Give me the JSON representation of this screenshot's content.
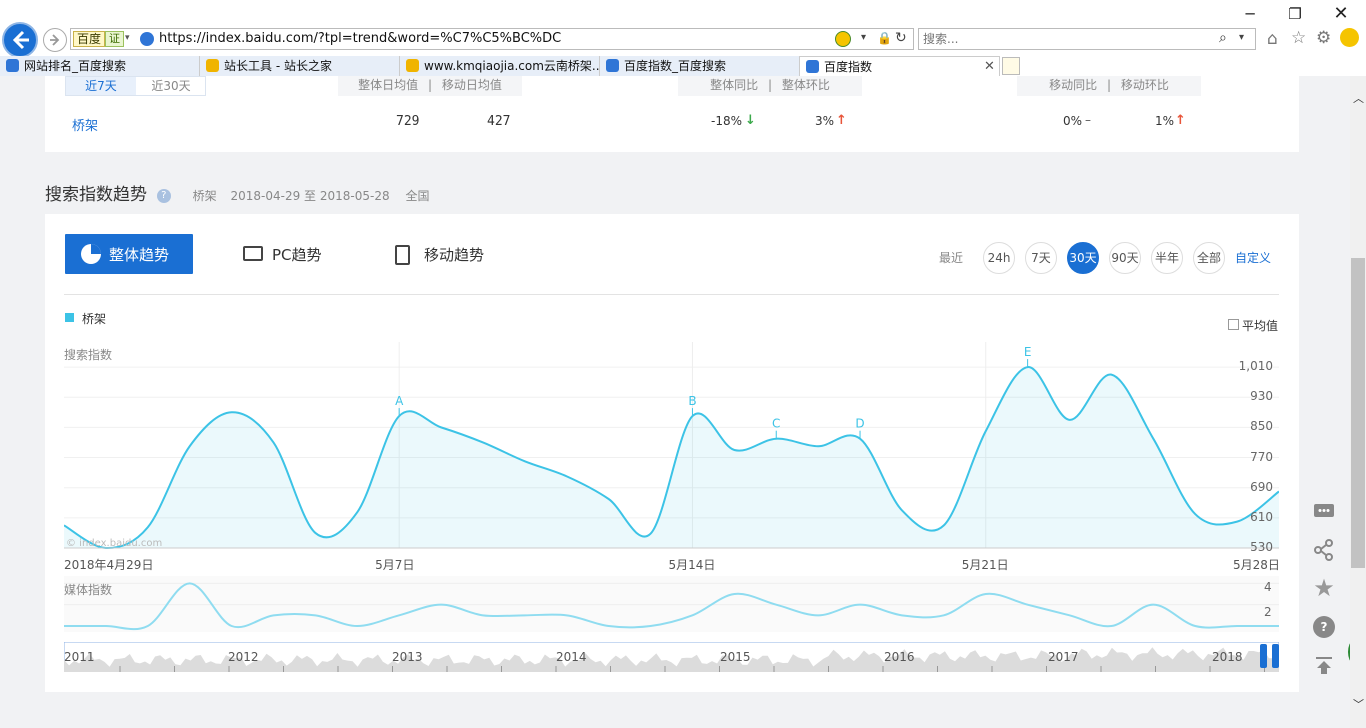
{
  "browser": {
    "url": "https://index.baidu.com/?tpl=trend&word=%C7%C5%BC%DC",
    "site_badge": "百度",
    "cert_badge": "证",
    "search_placeholder": "搜索...",
    "tabs": [
      {
        "label": "网站排名_百度搜索",
        "active": false
      },
      {
        "label": "站长工具 - 站长之家",
        "active": false
      },
      {
        "label": "www.kmqiaojia.com云南桥架...",
        "active": false
      },
      {
        "label": "百度指数_百度搜索",
        "active": false
      },
      {
        "label": "百度指数",
        "active": true
      }
    ]
  },
  "summary": {
    "period_tabs": [
      "近7天",
      "近30天"
    ],
    "col_headers": {
      "avg": [
        "整体日均值",
        "|",
        "移动日均值"
      ],
      "yoy": [
        "整体同比",
        "|",
        "整体环比"
      ],
      "mob": [
        "移动同比",
        "|",
        "移动环比"
      ]
    },
    "row": {
      "keyword": "桥架",
      "overall_avg": "729",
      "mobile_avg": "427",
      "overall_yoy": "-18%",
      "overall_mom": "3%",
      "mobile_yoy": "0%",
      "mobile_mom": "1%"
    },
    "colors": {
      "up": "#e8553a",
      "down": "#3ba94b"
    }
  },
  "trend": {
    "title": "搜索指数趋势",
    "meta": {
      "keyword": "桥架",
      "range": "2018-04-29 至 2018-05-28",
      "region": "全国"
    },
    "view_tabs": [
      {
        "label": "整体趋势",
        "active": true,
        "icon": "pie-icon"
      },
      {
        "label": "PC趋势",
        "active": false,
        "icon": "monitor-icon"
      },
      {
        "label": "移动趋势",
        "active": false,
        "icon": "phone-icon"
      }
    ],
    "recent_label": "最近",
    "ranges": [
      "24h",
      "7天",
      "30天",
      "90天",
      "半年",
      "全部"
    ],
    "active_range": "30天",
    "custom_label": "自定义",
    "avg_toggle": "平均值",
    "watermark": "© index.baidu.com",
    "accent": "#1a6fd3",
    "series_color": "#3cc3e6"
  },
  "chart_data": [
    {
      "type": "area",
      "ylabel": "搜索指数",
      "legend": [
        {
          "name": "桥架",
          "color": "#3cc3e6"
        }
      ],
      "x_ticks": [
        "2018年4月29日",
        "5月7日",
        "5月14日",
        "5月21日",
        "5月28日"
      ],
      "y_ticks": [
        "1,010",
        "930",
        "850",
        "770",
        "690",
        "610",
        "530"
      ],
      "ylim": [
        530,
        1050
      ],
      "x_day_start": 0,
      "x_day_end": 29,
      "series": [
        {
          "name": "桥架",
          "x": [
            0,
            1,
            2,
            3,
            4,
            5,
            6,
            7,
            8,
            9,
            10,
            11,
            12,
            13,
            14,
            15,
            16,
            17,
            18,
            19,
            20,
            21,
            22,
            23,
            24,
            25,
            26,
            27,
            28,
            29
          ],
          "values": [
            590,
            530,
            585,
            800,
            890,
            810,
            570,
            625,
            880,
            850,
            810,
            760,
            720,
            660,
            568,
            880,
            790,
            820,
            800,
            820,
            630,
            590,
            840,
            1010,
            870,
            990,
            820,
            620,
            600,
            680
          ]
        }
      ],
      "annotations": [
        {
          "label": "A",
          "x": 8,
          "y": 880
        },
        {
          "label": "B",
          "x": 15,
          "y": 880
        },
        {
          "label": "C",
          "x": 17,
          "y": 820
        },
        {
          "label": "D",
          "x": 19,
          "y": 820
        },
        {
          "label": "E",
          "x": 23,
          "y": 1010
        }
      ]
    },
    {
      "type": "area",
      "ylabel": "媒体指数",
      "y_ticks": [
        "4",
        "2"
      ],
      "ylim": [
        0,
        4.5
      ],
      "series": [
        {
          "name": "媒体指数",
          "x": [
            0,
            1,
            2,
            3,
            4,
            5,
            6,
            7,
            8,
            9,
            10,
            11,
            12,
            13,
            14,
            15,
            16,
            17,
            18,
            19,
            20,
            21,
            22,
            23,
            24,
            25,
            26,
            27,
            28,
            29
          ],
          "values": [
            0,
            0,
            0,
            4,
            0,
            1,
            1,
            0,
            1,
            2,
            1,
            1,
            1,
            0,
            0,
            1,
            3,
            2,
            1,
            2,
            1,
            1,
            3,
            2,
            1,
            0,
            2,
            0,
            0,
            0
          ]
        }
      ]
    },
    {
      "type": "area",
      "ylabel": "",
      "x_ticks": [
        "2011",
        "2012",
        "2013",
        "2014",
        "2015",
        "2016",
        "2017",
        "2018"
      ]
    }
  ]
}
